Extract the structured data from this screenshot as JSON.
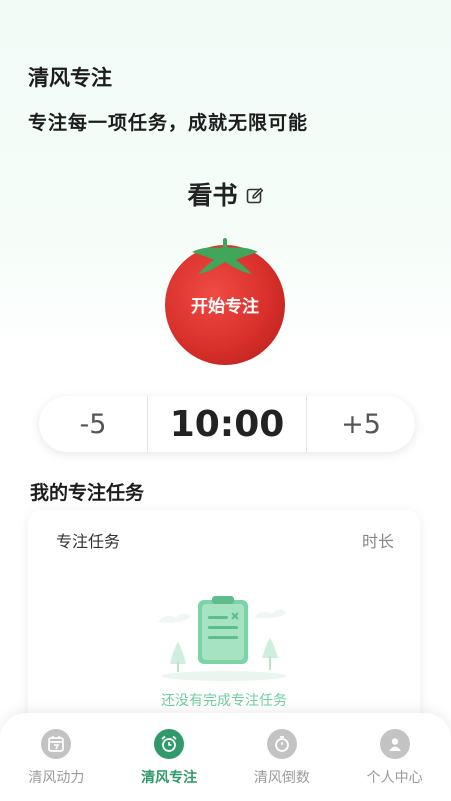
{
  "header": {
    "title": "清风专注",
    "subtitle": "专注每一项任务，成就无限可能"
  },
  "focus": {
    "task_name": "看书",
    "edit_icon": "edit-icon",
    "start_label": "开始专注",
    "colors": {
      "tomato": "#e0312c",
      "leaf": "#3fa65a"
    }
  },
  "timer": {
    "minus_label": "-5",
    "value": "10:00",
    "plus_label": "+5"
  },
  "tasks": {
    "section_title": "我的专注任务",
    "col_task": "专注任务",
    "col_duration": "时长",
    "empty_text": "还没有完成专注任务"
  },
  "tabbar": {
    "items": [
      {
        "label": "清风动力",
        "icon": "calendar-icon",
        "active": false
      },
      {
        "label": "清风专注",
        "icon": "alarm-clock-icon",
        "active": true
      },
      {
        "label": "清风倒数",
        "icon": "stopwatch-icon",
        "active": false
      },
      {
        "label": "个人中心",
        "icon": "user-icon",
        "active": false
      }
    ],
    "colors": {
      "active": "#2f9a6a",
      "inactive": "#9a9a9a"
    }
  }
}
